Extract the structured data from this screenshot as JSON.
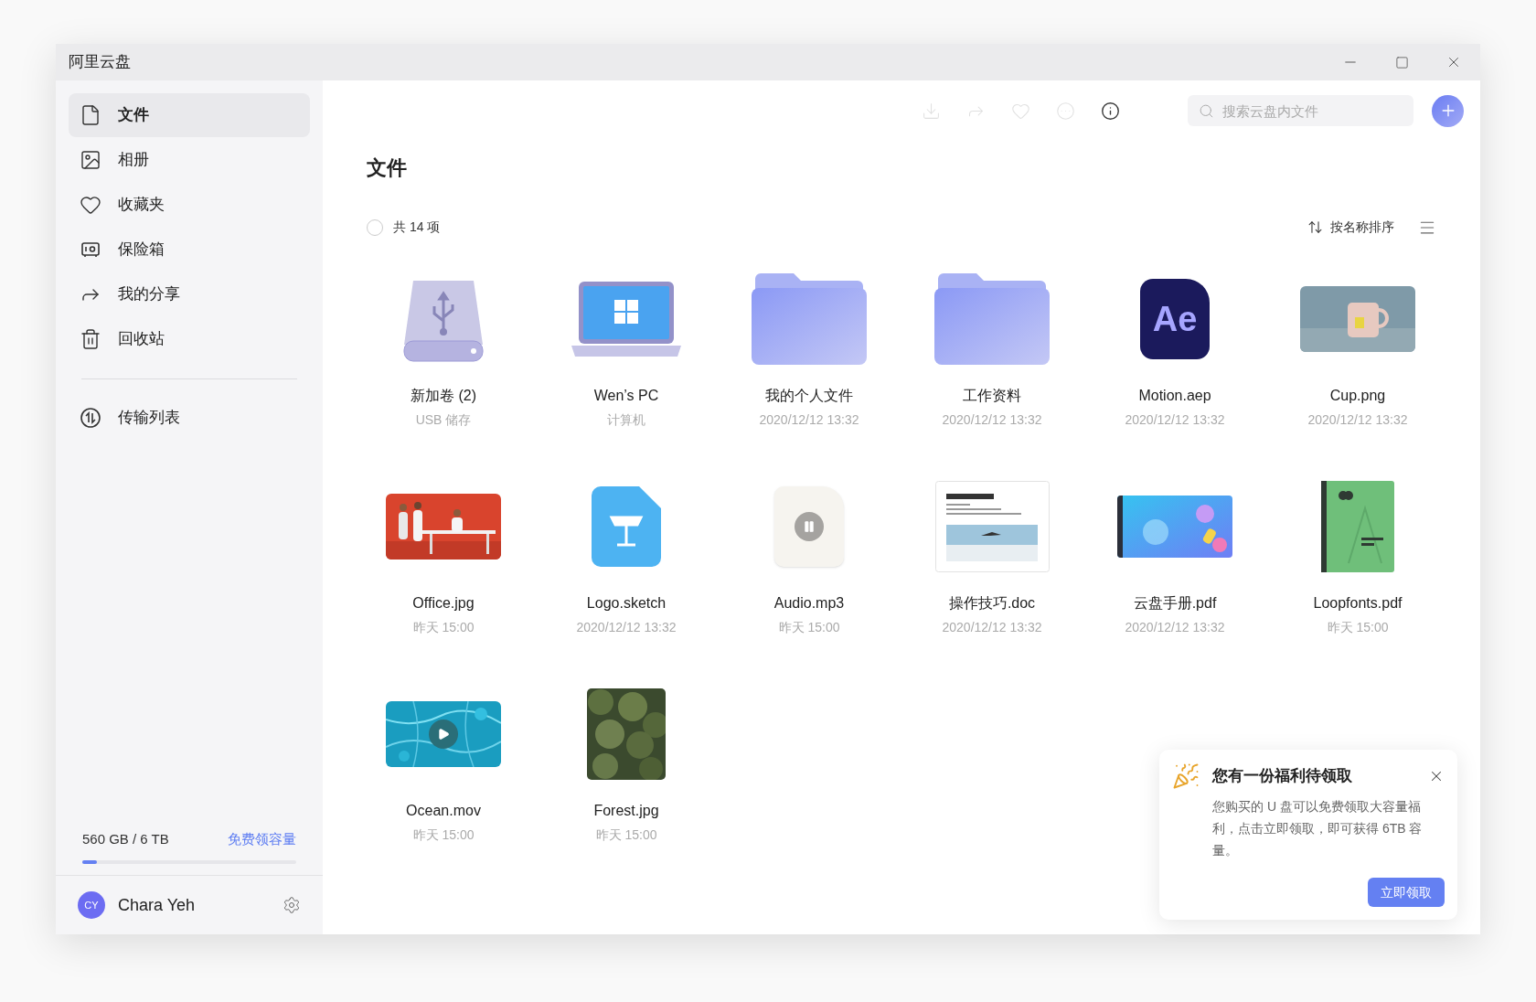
{
  "window": {
    "title": "阿里云盘"
  },
  "sidebar": {
    "items": [
      {
        "label": "文件",
        "selected": true
      },
      {
        "label": "相册",
        "selected": false
      },
      {
        "label": "收藏夹",
        "selected": false
      },
      {
        "label": "保险箱",
        "selected": false
      },
      {
        "label": "我的分享",
        "selected": false
      },
      {
        "label": "回收站",
        "selected": false
      }
    ],
    "transfer": {
      "label": "传输列表",
      "selected": false
    },
    "storage": {
      "usage": "560 GB / 6 TB",
      "link": "免费领容量",
      "level": 0.067
    },
    "user": {
      "initials": "CY",
      "name": "Chara Yeh"
    }
  },
  "toolbar": {
    "buttons": [
      {
        "disabled": true
      },
      {
        "disabled": true
      },
      {
        "disabled": true
      },
      {
        "disabled": true
      },
      {
        "disabled": false
      }
    ],
    "search": {
      "placeholder": "搜索云盘内文件"
    }
  },
  "heading": "文件",
  "summary": {
    "count": "共 14 项",
    "checked": false
  },
  "sort": {
    "label": "按名称排序"
  },
  "files": [
    {
      "kind": "drive",
      "name": "新加卷 (2)",
      "sub": "USB 储存"
    },
    {
      "kind": "laptop",
      "name": "Wen’s PC",
      "sub": "计算机"
    },
    {
      "kind": "folder",
      "name": "我的个人文件",
      "sub": "2020/12/12 13:32"
    },
    {
      "kind": "folder",
      "name": "工作资料",
      "sub": "2020/12/12 13:32"
    },
    {
      "kind": "app",
      "badge": "Ae",
      "name": "Motion.aep",
      "sub": "2020/12/12 13:32"
    },
    {
      "kind": "picture",
      "name": "Cup.png",
      "sub": "2020/12/12 13:32"
    },
    {
      "kind": "picture",
      "name": "Office.jpg",
      "sub": "昨天 15:00"
    },
    {
      "kind": "keynote",
      "name": "Logo.sketch",
      "sub": "2020/12/12 13:32"
    },
    {
      "kind": "audio",
      "name": "Audio.mp3",
      "sub": "昨天 15:00"
    },
    {
      "kind": "doc",
      "name": "操作技巧.doc",
      "sub": "2020/12/12 13:32"
    },
    {
      "kind": "picture",
      "name": "云盘手册.pdf",
      "sub": "2020/12/12 13:32"
    },
    {
      "kind": "book",
      "name": "Loopfonts.pdf",
      "sub": "昨天 15:00"
    },
    {
      "kind": "video",
      "name": "Ocean.mov",
      "sub": "昨天 15:00"
    },
    {
      "kind": "picture",
      "name": "Forest.jpg",
      "sub": "昨天 15:00"
    }
  ],
  "notification": {
    "title": "您有一份福利待领取",
    "body": "您购买的 U 盘可以免费领取大容量福利，点击立即领取，即可获得 6TB 容量。",
    "button": "立即领取"
  }
}
